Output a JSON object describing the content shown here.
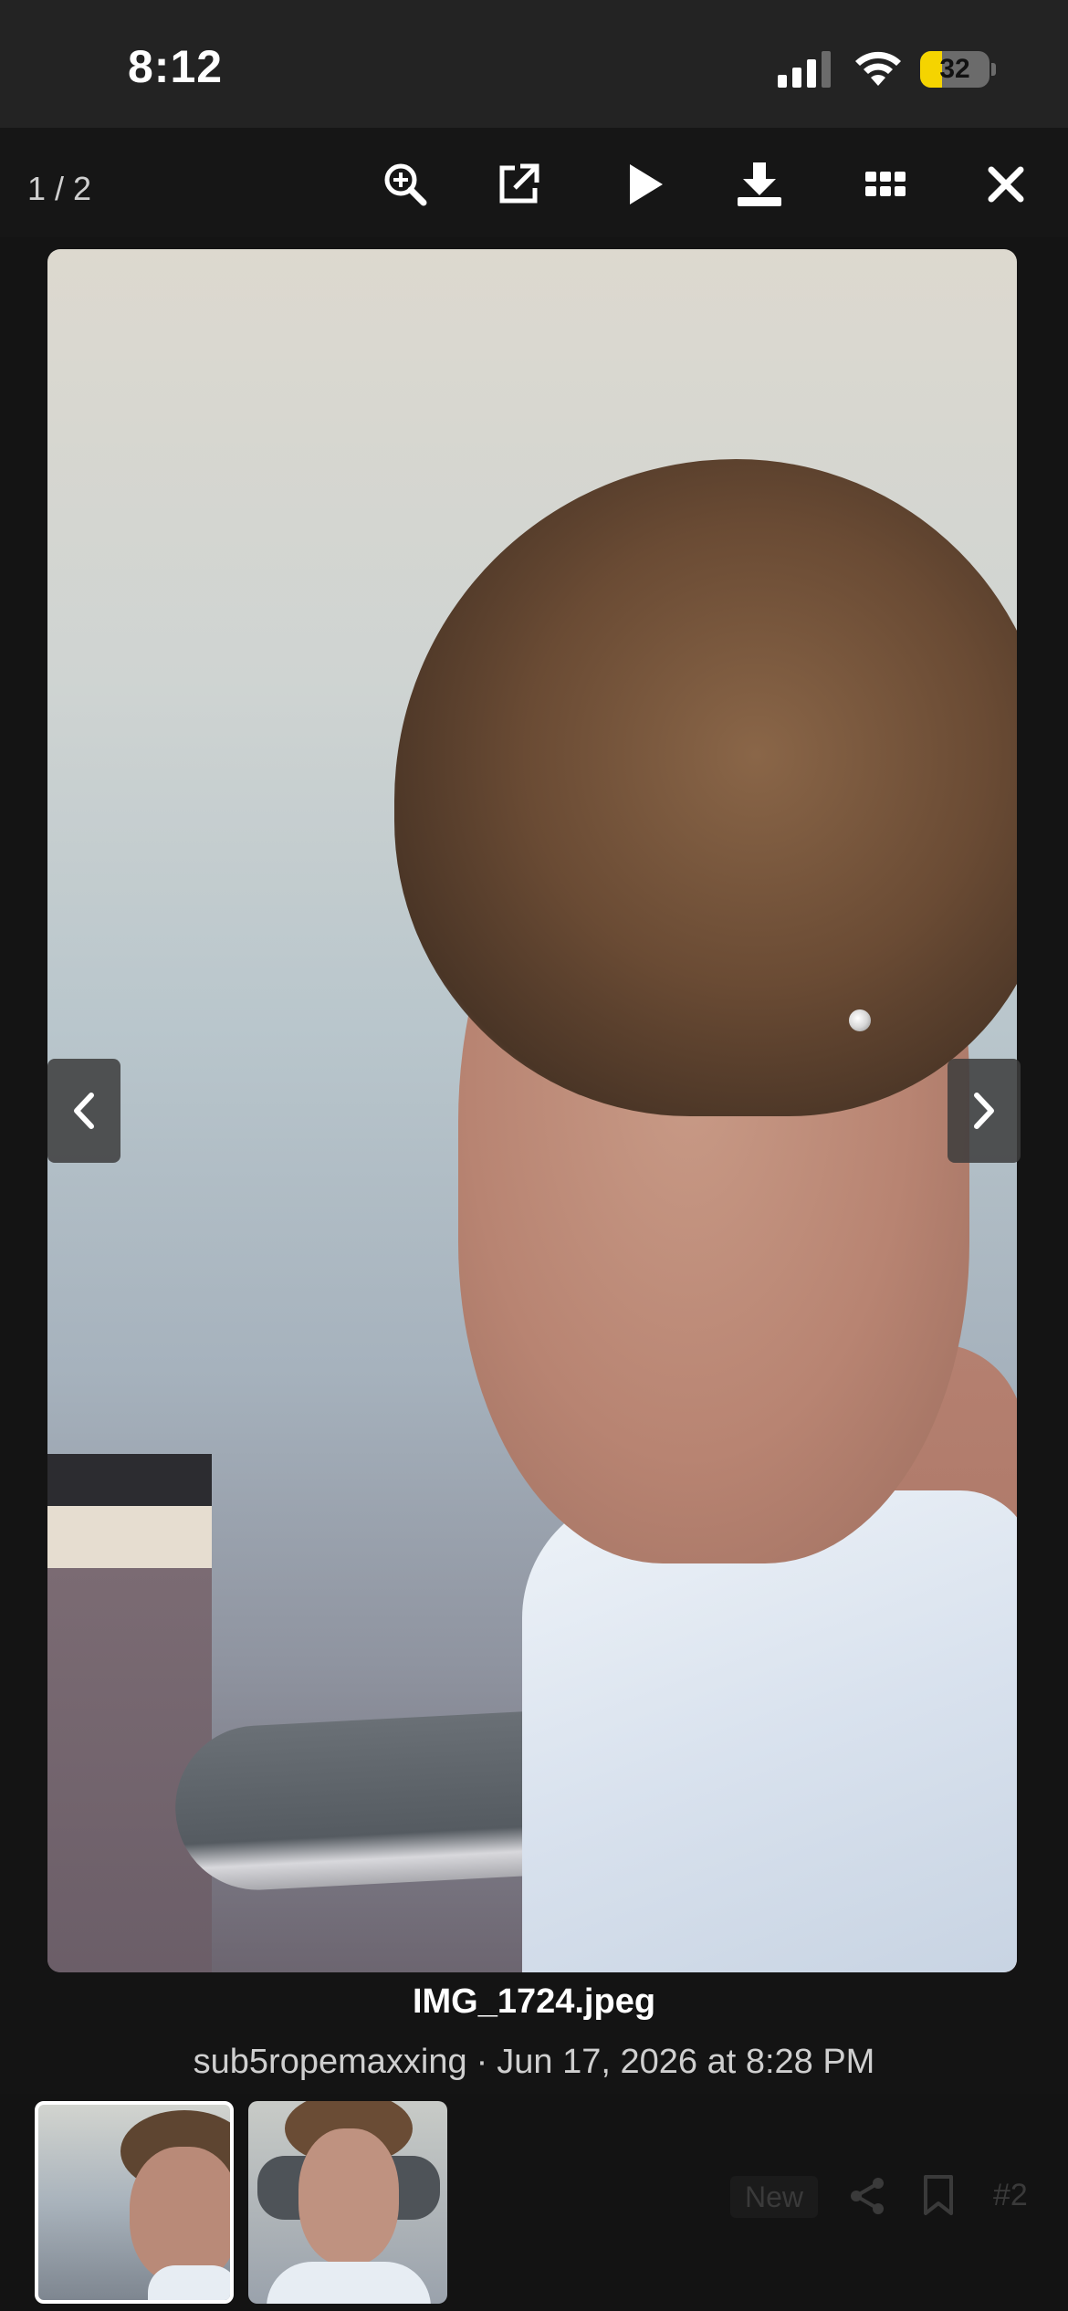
{
  "status_bar": {
    "time": "8:12",
    "battery_percent": "32",
    "battery_level": 0.32,
    "battery_color": "#f5d400"
  },
  "toolbar": {
    "counter": "1 / 2",
    "icons": [
      "zoom-in-icon",
      "open-external-icon",
      "play-icon",
      "download-icon",
      "grid-icon",
      "close-icon"
    ]
  },
  "viewer": {
    "image_description_icon": "photo",
    "prev_icon": "chevron-left-icon",
    "next_icon": "chevron-right-icon"
  },
  "caption": {
    "filename": "IMG_1724.jpeg",
    "author": "sub5ropemaxxing",
    "separator": "·",
    "date": "Jun 17, 2026 at 8:28 PM"
  },
  "bottom_bar": {
    "new_label": "New",
    "index_label": "#2",
    "active_thumbnail": 1,
    "thumbnail_count": 2
  },
  "colors": {
    "background": "#141414",
    "status_bar": "#232323",
    "accent_active_border": "#ffffff"
  }
}
